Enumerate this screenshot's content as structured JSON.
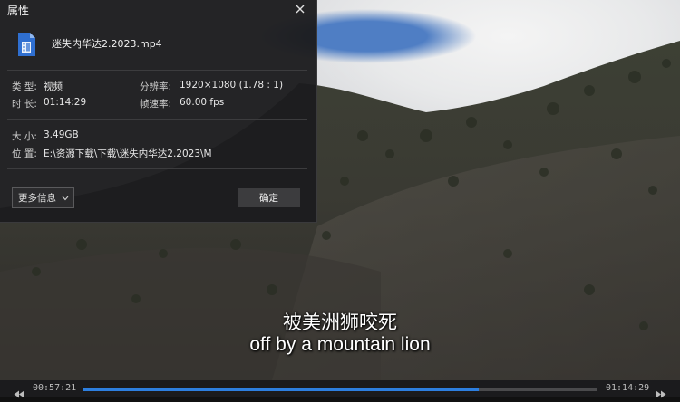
{
  "dialog": {
    "title": "属性",
    "file_name": "迷失内华达2.2023.mp4",
    "type_label": "类 型:",
    "type_value": "视频",
    "duration_label": "时 长:",
    "duration_value": "01:14:29",
    "resolution_label": "分辨率:",
    "resolution_value": "1920×1080 (1.78 : 1)",
    "framerate_label": "帧速率:",
    "framerate_value": "60.00 fps",
    "size_label": "大 小:",
    "size_value": "3.49GB",
    "location_label": "位 置:",
    "location_value": "E:\\资源下载\\下载\\迷失内华达2.2023\\M",
    "more_info_label": "更多信息",
    "ok_label": "确定",
    "close_icon": "close-icon",
    "file_icon": "video-file-icon"
  },
  "subtitles": {
    "chinese": "被美洲狮咬死",
    "english": "off by a mountain lion"
  },
  "player": {
    "current_time": "00:57:21",
    "total_time": "01:14:29",
    "progress": 0.77,
    "accent_color": "#2d7fe0",
    "prev_icon": "rewind-icon",
    "next_icon": "fast-forward-icon"
  }
}
